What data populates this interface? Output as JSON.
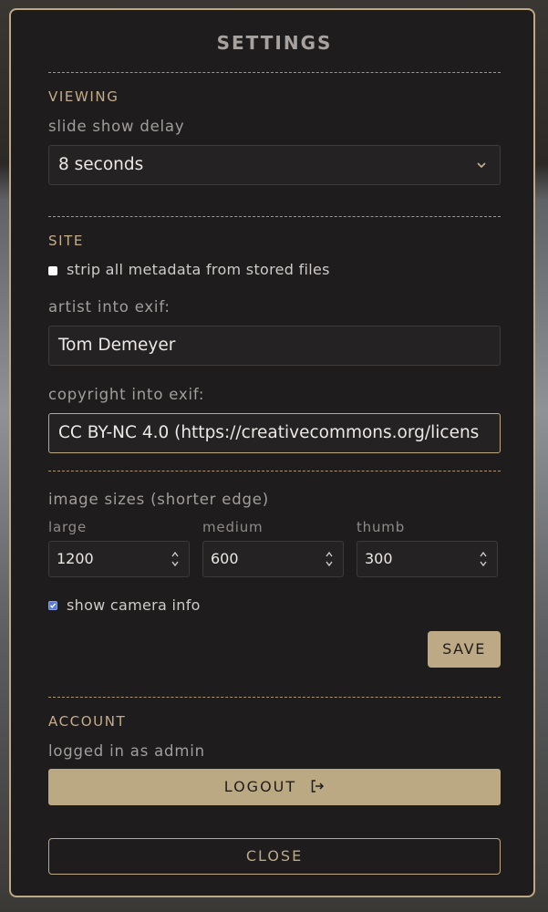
{
  "title": "SETTINGS",
  "viewing": {
    "heading": "VIEWING",
    "slideshow_label": "slide show delay",
    "slideshow_value": "8 seconds"
  },
  "site": {
    "heading": "SITE",
    "strip_metadata_label": "strip all metadata from stored files",
    "strip_metadata_checked": false,
    "artist_label": "artist into exif:",
    "artist_value": "Tom Demeyer",
    "copyright_label": "copyright into exif:",
    "copyright_value": "CC BY-NC 4.0 (https://creativecommons.org/licens",
    "image_sizes_label": "image sizes (shorter edge)",
    "sizes": [
      {
        "label": "large",
        "value": "1200"
      },
      {
        "label": "medium",
        "value": "600"
      },
      {
        "label": "thumb",
        "value": "300"
      }
    ],
    "camera_info_label": "show camera info",
    "camera_info_checked": true,
    "save_label": "SAVE"
  },
  "account": {
    "heading": "ACCOUNT",
    "status": "logged in as admin",
    "logout_label": "LOGOUT"
  },
  "close_label": "CLOSE",
  "colors": {
    "accent": "#bda985",
    "panel_bg": "#1e1c1c",
    "checkbox_checked": "#5b7bd8"
  }
}
